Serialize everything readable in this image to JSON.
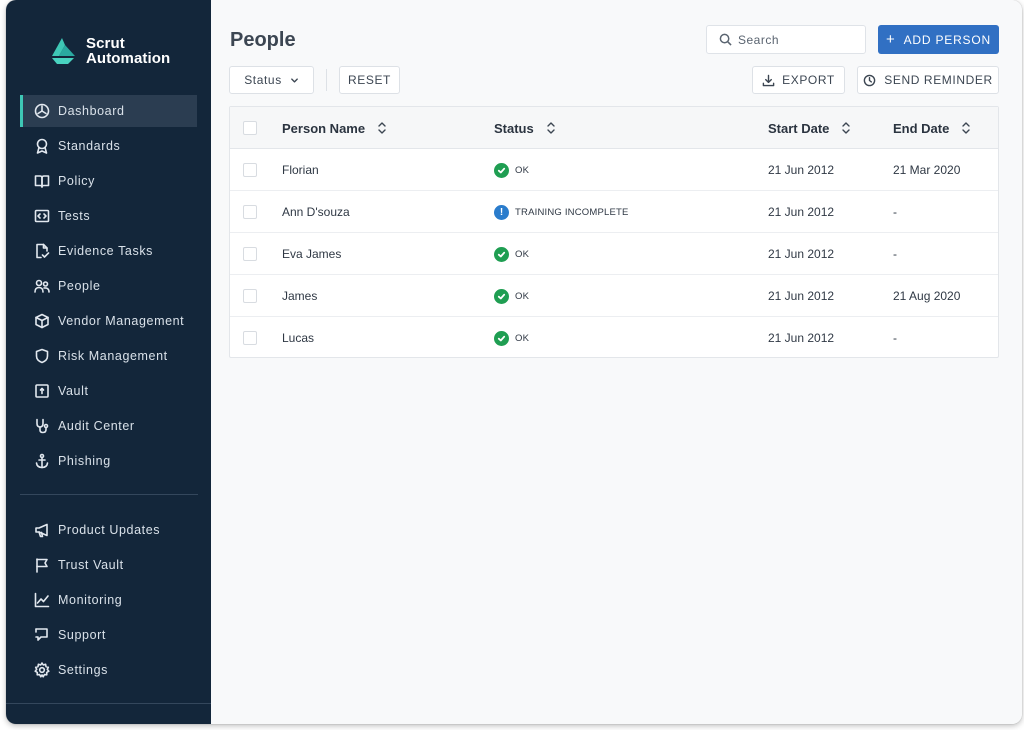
{
  "app": {
    "logo_line1": "Scrut",
    "logo_line2": "Automation",
    "accent_color": "#3ec7b5"
  },
  "sidebar": {
    "items": [
      {
        "label": "Dashboard",
        "icon": "dashboard-icon",
        "active": true
      },
      {
        "label": "Standards",
        "icon": "award-icon"
      },
      {
        "label": "Policy",
        "icon": "book-icon"
      },
      {
        "label": "Tests",
        "icon": "code-icon"
      },
      {
        "label": "Evidence Tasks",
        "icon": "file-check-icon"
      },
      {
        "label": "People",
        "icon": "people-icon"
      },
      {
        "label": "Vendor Management",
        "icon": "box-icon"
      },
      {
        "label": "Risk Management",
        "icon": "shield-icon"
      },
      {
        "label": "Vault",
        "icon": "vault-icon"
      },
      {
        "label": "Audit Center",
        "icon": "stethoscope-icon"
      },
      {
        "label": "Phishing",
        "icon": "anchor-icon"
      }
    ],
    "bottom_items": [
      {
        "label": "Product Updates",
        "icon": "megaphone-icon"
      },
      {
        "label": "Trust Vault",
        "icon": "flag-icon"
      },
      {
        "label": "Monitoring",
        "icon": "line-chart-icon"
      },
      {
        "label": "Support",
        "icon": "support-icon"
      },
      {
        "label": "Settings",
        "icon": "gear-icon"
      }
    ]
  },
  "header": {
    "title": "People",
    "search_placeholder": "Search",
    "add_label": "ADD PERSON"
  },
  "toolbar": {
    "status_label": "Status",
    "reset_label": "RESET",
    "export_label": "EXPORT",
    "reminder_label": "SEND REMINDER"
  },
  "table": {
    "columns": [
      "Person Name",
      "Status",
      "Start Date",
      "End Date"
    ],
    "rows": [
      {
        "name": "Florian",
        "status": "OK",
        "status_type": "ok",
        "start": "21 Jun 2012",
        "end": "21 Mar 2020"
      },
      {
        "name": "Ann D'souza",
        "status": "TRAINING INCOMPLETE",
        "status_type": "warn",
        "start": "21 Jun 2012",
        "end": "-"
      },
      {
        "name": "Eva James",
        "status": "OK",
        "status_type": "ok",
        "start": "21 Jun 2012",
        "end": "-"
      },
      {
        "name": "James",
        "status": "OK",
        "status_type": "ok",
        "start": "21 Jun 2012",
        "end": "21 Aug 2020"
      },
      {
        "name": "Lucas",
        "status": "OK",
        "status_type": "ok",
        "start": "21 Jun 2012",
        "end": "-"
      }
    ],
    "status_colors": {
      "ok": "#1f9e52",
      "warn": "#2a7ccc"
    }
  }
}
